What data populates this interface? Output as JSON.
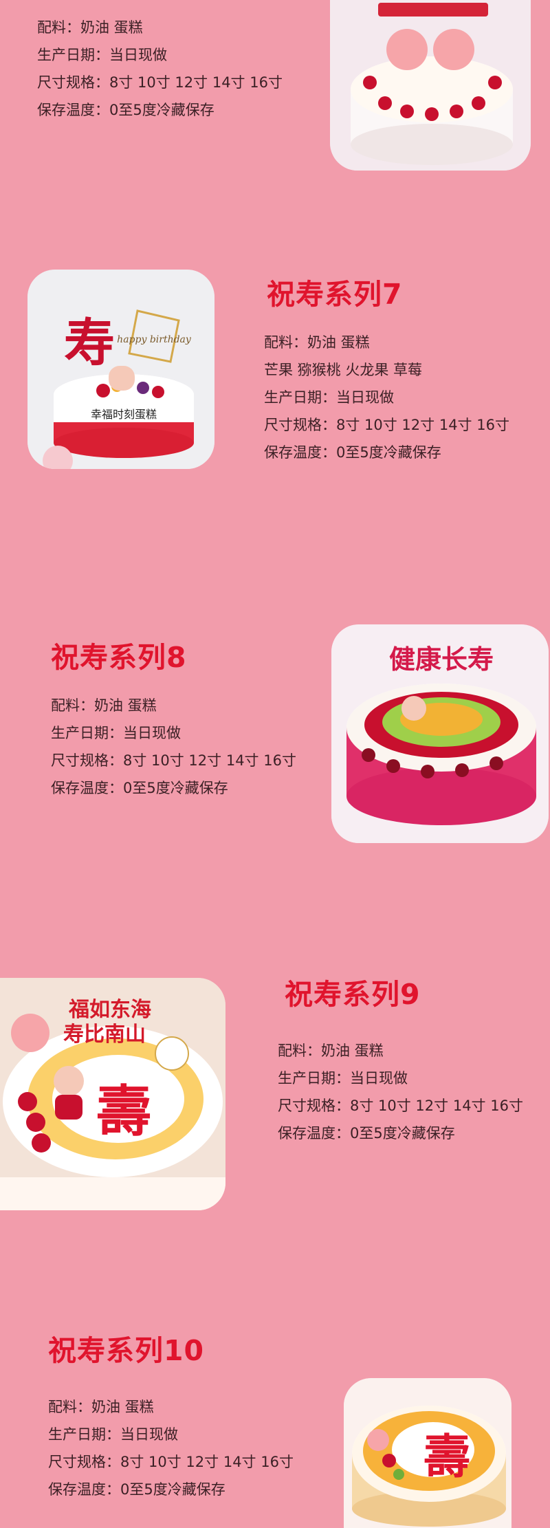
{
  "sections": [
    {
      "specs": [
        "配料：奶油 蛋糕",
        "生产日期：当日现做",
        "尺寸规格：8寸 10寸 12寸 14寸 16寸",
        "保存温度：0至5度冷藏保存"
      ]
    },
    {
      "title": "祝寿系列7",
      "specs": [
        "配料：奶油 蛋糕",
        "芒果 猕猴桃 火龙果 草莓",
        "生产日期：当日现做",
        "尺寸规格：8寸 10寸 12寸 14寸 16寸",
        "保存温度：0至5度冷藏保存"
      ],
      "cake_text": {
        "big": "寿",
        "plaque": "幸福时刻蛋糕",
        "topper": "happy birthday"
      }
    },
    {
      "title": "祝寿系列8",
      "specs": [
        "配料：奶油 蛋糕",
        "生产日期：当日现做",
        "尺寸规格：8寸 10寸 12寸 14寸 16寸",
        "保存温度：0至5度冷藏保存"
      ],
      "cake_text": {
        "topper": "健康长寿"
      }
    },
    {
      "title": "祝寿系列9",
      "specs": [
        "配料：奶油 蛋糕",
        "生产日期：当日现做",
        "尺寸规格：8寸 10寸 12寸 14寸 16寸",
        "保存温度：0至5度冷藏保存"
      ],
      "cake_text": {
        "topper": "福如东海",
        "topper2": "寿比南山",
        "big": "壽"
      }
    },
    {
      "title": "祝寿系列10",
      "specs": [
        "配料：奶油 蛋糕",
        "生产日期：当日现做",
        "尺寸规格：8寸 10寸 12寸 14寸 16寸",
        "保存温度：0至5度冷藏保存"
      ],
      "cake_text": {
        "big": "壽"
      }
    }
  ],
  "colors": {
    "background": "#f29cab",
    "title": "#e0142d",
    "text": "#3a1f24"
  }
}
